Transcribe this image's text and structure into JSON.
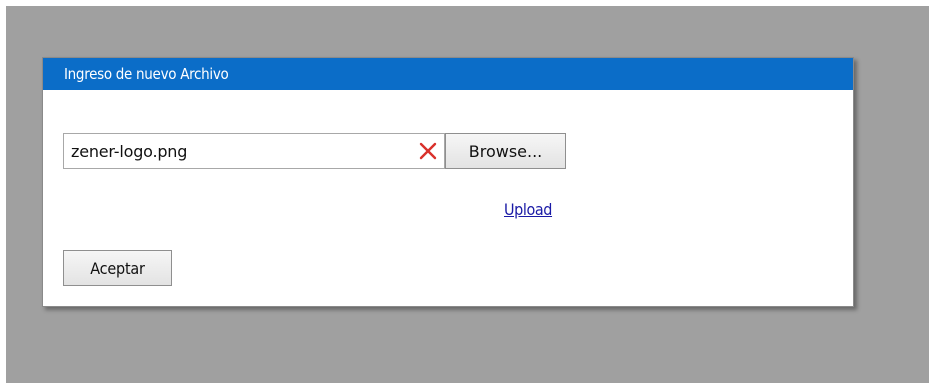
{
  "dialog": {
    "title": "Ingreso de nuevo Archivo",
    "title_bar_color": "#0b6dc8"
  },
  "file_field": {
    "value": "zener-logo.png",
    "clear_icon": "close-x-icon",
    "clear_icon_color": "#d9312b"
  },
  "buttons": {
    "browse_label": "Browse...",
    "upload_label": "Upload",
    "accept_label": "Aceptar"
  },
  "backdrop_color": "#a0a0a0"
}
